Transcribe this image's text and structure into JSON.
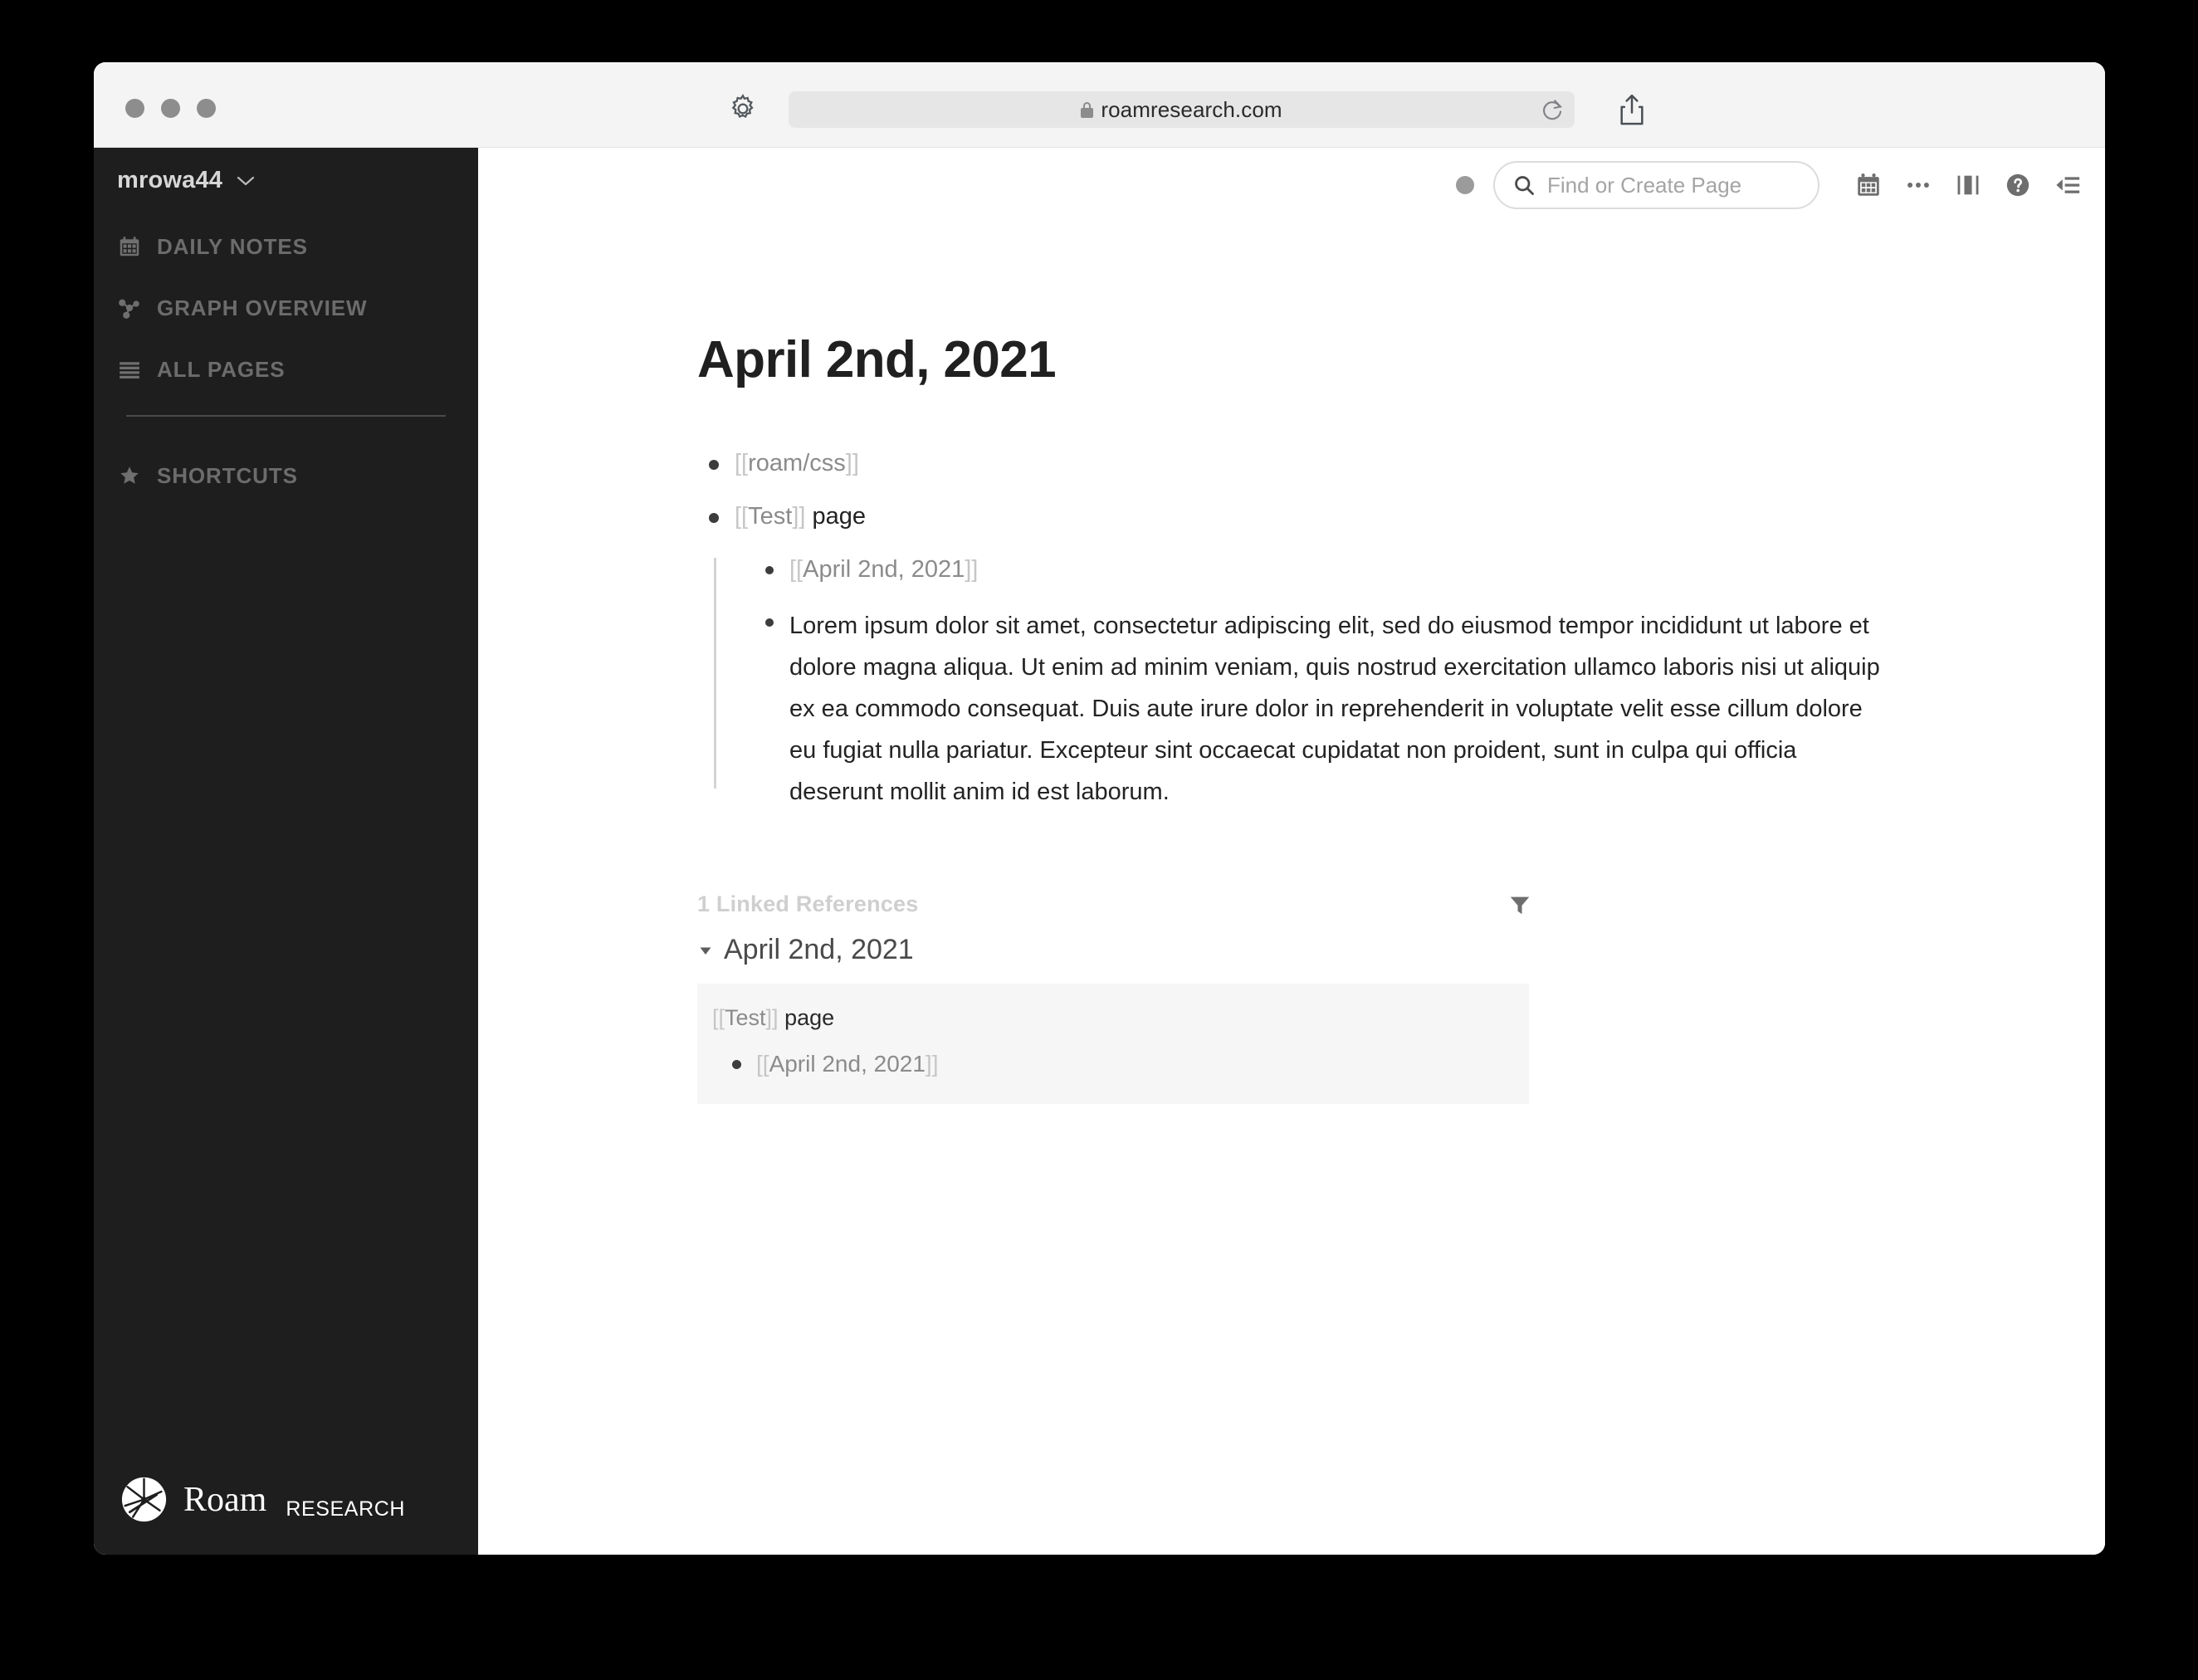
{
  "browser": {
    "url": "roamresearch.com",
    "lock_icon": "lock-icon",
    "gear_icon": "gear-icon",
    "reload_icon": "reload-icon",
    "share_icon": "share-icon",
    "cloud_icon": "cloud-icon",
    "traffic_lights": [
      "close",
      "minimize",
      "zoom"
    ]
  },
  "sidebar": {
    "user": "mrowa44",
    "chevron_icon": "chevron-down-icon",
    "items": [
      {
        "label": "DAILY NOTES",
        "icon": "calendar-icon"
      },
      {
        "label": "GRAPH OVERVIEW",
        "icon": "graph-icon"
      },
      {
        "label": "ALL PAGES",
        "icon": "list-lines-icon"
      }
    ],
    "shortcuts": {
      "label": "SHORTCUTS",
      "icon": "star-icon"
    },
    "logo": {
      "word": "Roam",
      "sub": "RESEARCH",
      "mark_icon": "roam-logo-icon"
    }
  },
  "toolbar": {
    "status_dot": "status-dot",
    "search_placeholder": "Find or Create Page",
    "search_icon": "search-icon",
    "icons": [
      {
        "name": "calendar-icon"
      },
      {
        "name": "more-horizontal-icon"
      },
      {
        "name": "split-view-icon"
      },
      {
        "name": "help-icon"
      },
      {
        "name": "collapse-sidebar-icon"
      }
    ]
  },
  "page": {
    "title": "April 2nd, 2021",
    "blocks": [
      {
        "open_brk": "[[",
        "ref": "roam/css",
        "close_brk": "]]",
        "tail": ""
      },
      {
        "open_brk": "[[",
        "ref": "Test",
        "close_brk": "]]",
        "tail": " page"
      }
    ],
    "nested": {
      "ref_block": {
        "open_brk": "[[",
        "ref": "April 2nd, 2021",
        "close_brk": "]]"
      },
      "paragraph": "Lorem ipsum dolor sit amet, consectetur adipiscing elit, sed do eiusmod tempor incididunt ut labore et dolore magna aliqua. Ut enim ad minim veniam, quis nostrud exercitation ullamco laboris nisi ut aliquip ex ea commodo consequat. Duis aute irure dolor in reprehenderit in voluptate velit esse cillum dolore eu fugiat nulla pariatur. Excepteur sint occaecat cupidatat non proident, sunt in culpa qui officia deserunt mollit anim id est laborum."
    }
  },
  "linked_references": {
    "count_label": "1 Linked References",
    "filter_icon": "filter-icon",
    "caret_icon": "caret-down-icon",
    "page_title": "April 2nd, 2021",
    "block": {
      "open_brk": "[[",
      "ref": "Test",
      "close_brk": "]]",
      "tail": " page",
      "child": {
        "open_brk": "[[",
        "ref": "April 2nd, 2021",
        "close_brk": "]]"
      }
    }
  },
  "colors": {
    "sidebar_bg": "#1e1e1e",
    "chrome_bg": "#f4f4f4",
    "page_bg": "#ffffff",
    "ref_block_bg": "#f6f6f6",
    "page_ref_text": "#8b8b8b",
    "bracket": "#c6c6c6"
  }
}
